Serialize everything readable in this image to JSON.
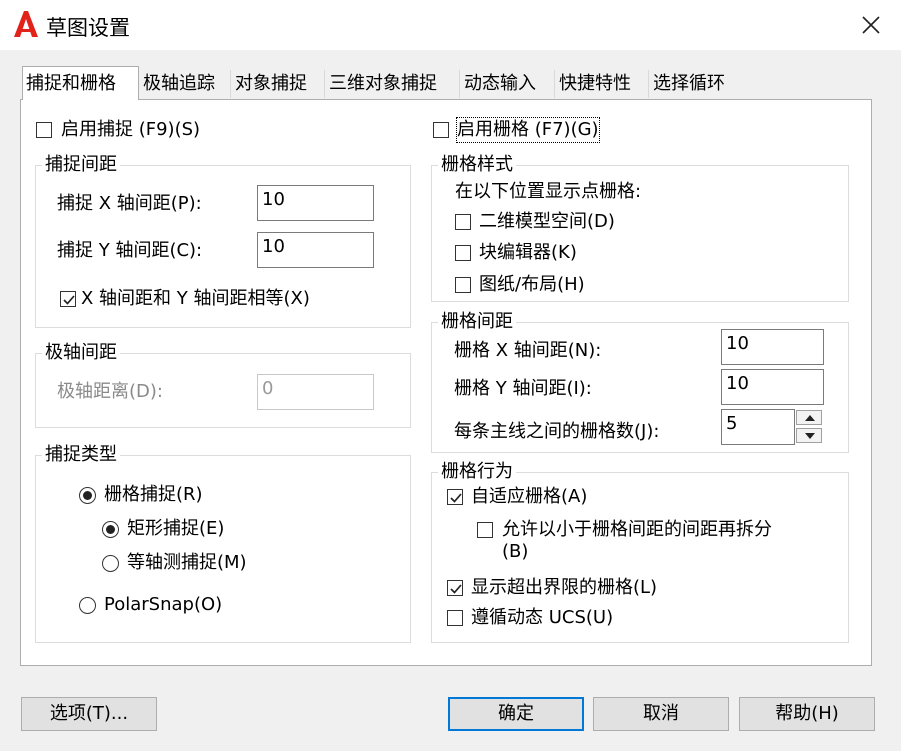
{
  "window": {
    "title": "草图设置",
    "logo_color": "#e2231a",
    "close_icon": "close-icon"
  },
  "tabs": [
    "捕捉和栅格",
    "极轴追踪",
    "对象捕捉",
    "三维对象捕捉",
    "动态输入",
    "快捷特性",
    "选择循环"
  ],
  "left": {
    "snap_on": {
      "label": "启用捕捉 (F9)(S)",
      "checked": false
    },
    "snap_spacing": {
      "legend": "捕捉间距",
      "x_label": "捕捉 X 轴间距(P):",
      "x_value": "10",
      "y_label": "捕捉 Y 轴间距(C):",
      "y_value": "10",
      "equal_label": "X 轴间距和 Y 轴间距相等(X)",
      "equal_checked": true
    },
    "polar_spacing": {
      "legend": "极轴间距",
      "distance_label": "极轴距离(D):",
      "distance_value": "0"
    },
    "snap_type": {
      "legend": "捕捉类型",
      "grid_snap": "栅格捕捉(R)",
      "rect_snap": "矩形捕捉(E)",
      "iso_snap": "等轴测捕捉(M)",
      "polar_snap": "PolarSnap(O)",
      "selected_main": "grid_snap",
      "selected_sub": "rect_snap"
    }
  },
  "right": {
    "grid_on": {
      "label": "启用栅格 (F7)(G)",
      "checked": false
    },
    "grid_style": {
      "legend": "栅格样式",
      "caption": "在以下位置显示点栅格:",
      "model_2d": "二维模型空间(D)",
      "block_editor": "块编辑器(K)",
      "sheet_layout": "图纸/布局(H)"
    },
    "grid_spacing": {
      "legend": "栅格间距",
      "x_label": "栅格 X 轴间距(N):",
      "x_value": "10",
      "y_label": "栅格 Y 轴间距(I):",
      "y_value": "10",
      "major_label": "每条主线之间的栅格数(J):",
      "major_value": "5"
    },
    "grid_behavior": {
      "legend": "栅格行为",
      "adaptive": {
        "label": "自适应栅格(A)",
        "checked": true
      },
      "subdivide_line1": "允许以小于栅格间距的间距再拆分",
      "subdivide_line2": "(B)",
      "subdivide_checked": false,
      "beyond_limits": {
        "label": "显示超出界限的栅格(L)",
        "checked": true
      },
      "follow_ucs": {
        "label": "遵循动态 UCS(U)",
        "checked": false
      }
    }
  },
  "buttons": {
    "options": "选项(T)...",
    "ok": "确定",
    "cancel": "取消",
    "help": "帮助(H)"
  }
}
